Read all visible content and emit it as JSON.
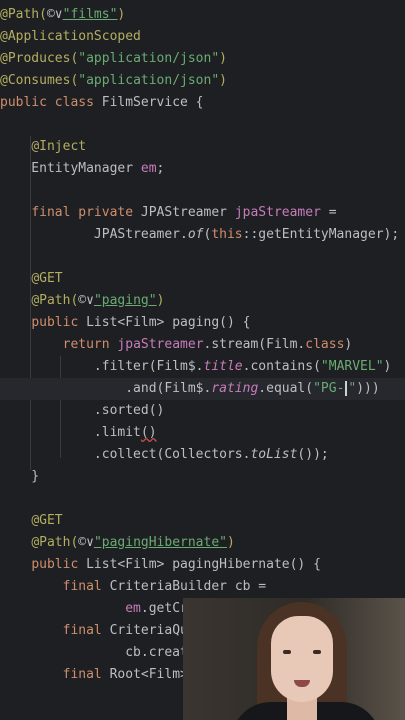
{
  "editor": {
    "lines": [
      {
        "tokens": [
          {
            "t": "@Path(",
            "c": "ann"
          },
          {
            "t": "©∨",
            "c": "hint"
          },
          {
            "t": "\"films\"",
            "c": "str-ul"
          },
          {
            "t": ")",
            "c": "ann"
          }
        ]
      },
      {
        "tokens": [
          {
            "t": "@ApplicationScoped",
            "c": "ann"
          }
        ]
      },
      {
        "tokens": [
          {
            "t": "@Produces(",
            "c": "ann"
          },
          {
            "t": "\"application/json\"",
            "c": "str"
          },
          {
            "t": ")",
            "c": "ann"
          }
        ]
      },
      {
        "tokens": [
          {
            "t": "@Consumes(",
            "c": "ann"
          },
          {
            "t": "\"application/json\"",
            "c": "str"
          },
          {
            "t": ")",
            "c": "ann"
          }
        ]
      },
      {
        "tokens": [
          {
            "t": "public class ",
            "c": "kw"
          },
          {
            "t": "FilmService {",
            "c": "plain"
          }
        ]
      },
      {
        "tokens": []
      },
      {
        "tokens": [
          {
            "t": "    ",
            "c": "plain"
          },
          {
            "t": "@Inject",
            "c": "ann"
          }
        ]
      },
      {
        "tokens": [
          {
            "t": "    EntityManager ",
            "c": "plain"
          },
          {
            "t": "em",
            "c": "field"
          },
          {
            "t": ";",
            "c": "plain"
          }
        ]
      },
      {
        "tokens": []
      },
      {
        "tokens": [
          {
            "t": "    ",
            "c": "plain"
          },
          {
            "t": "final private ",
            "c": "kw"
          },
          {
            "t": "JPAStreamer ",
            "c": "plain"
          },
          {
            "t": "jpaStreamer",
            "c": "field"
          },
          {
            "t": " =",
            "c": "plain"
          }
        ]
      },
      {
        "tokens": [
          {
            "t": "            JPAStreamer.",
            "c": "plain"
          },
          {
            "t": "of",
            "c": "mi"
          },
          {
            "t": "(",
            "c": "plain"
          },
          {
            "t": "this",
            "c": "kw"
          },
          {
            "t": "::getEntityManager);",
            "c": "plain"
          }
        ]
      },
      {
        "tokens": []
      },
      {
        "tokens": [
          {
            "t": "    ",
            "c": "plain"
          },
          {
            "t": "@GET",
            "c": "ann"
          }
        ]
      },
      {
        "tokens": [
          {
            "t": "    ",
            "c": "plain"
          },
          {
            "t": "@Path(",
            "c": "ann"
          },
          {
            "t": "©∨",
            "c": "hint"
          },
          {
            "t": "\"paging\"",
            "c": "str-ul"
          },
          {
            "t": ")",
            "c": "ann"
          }
        ]
      },
      {
        "tokens": [
          {
            "t": "    ",
            "c": "plain"
          },
          {
            "t": "public ",
            "c": "kw"
          },
          {
            "t": "List<Film> paging() {",
            "c": "plain"
          }
        ]
      },
      {
        "tokens": [
          {
            "t": "        ",
            "c": "plain"
          },
          {
            "t": "return ",
            "c": "kw"
          },
          {
            "t": "jpaStreamer",
            "c": "field"
          },
          {
            "t": ".stream(Film.",
            "c": "plain"
          },
          {
            "t": "class",
            "c": "kw"
          },
          {
            "t": ")",
            "c": "plain"
          }
        ]
      },
      {
        "tokens": [
          {
            "t": "            .filter(Film$.",
            "c": "plain"
          },
          {
            "t": "title",
            "c": "fieldi"
          },
          {
            "t": ".contains(",
            "c": "plain"
          },
          {
            "t": "\"MARVEL\"",
            "c": "str"
          },
          {
            "t": ")",
            "c": "plain"
          }
        ]
      },
      {
        "current": true,
        "tokens": [
          {
            "t": "                .and(Film$.",
            "c": "plain"
          },
          {
            "t": "rating",
            "c": "fieldi"
          },
          {
            "t": ".equal(",
            "c": "plain"
          },
          {
            "t": "\"PG-",
            "c": "str"
          },
          {
            "t": "",
            "c": "caret"
          },
          {
            "t": "\"",
            "c": "str"
          },
          {
            "t": ")))",
            "c": "plain"
          }
        ]
      },
      {
        "tokens": [
          {
            "t": "            .sorted()",
            "c": "plain"
          }
        ]
      },
      {
        "tokens": [
          {
            "t": "            .limit",
            "c": "plain"
          },
          {
            "t": "()",
            "c": "plain-wavy"
          }
        ]
      },
      {
        "tokens": [
          {
            "t": "            .collect(Collectors.",
            "c": "plain"
          },
          {
            "t": "toList",
            "c": "mi"
          },
          {
            "t": "());",
            "c": "plain"
          }
        ]
      },
      {
        "tokens": [
          {
            "t": "    }",
            "c": "plain"
          }
        ]
      },
      {
        "tokens": []
      },
      {
        "tokens": [
          {
            "t": "    ",
            "c": "plain"
          },
          {
            "t": "@GET",
            "c": "ann"
          }
        ]
      },
      {
        "tokens": [
          {
            "t": "    ",
            "c": "plain"
          },
          {
            "t": "@Path(",
            "c": "ann"
          },
          {
            "t": "©∨",
            "c": "hint"
          },
          {
            "t": "\"pagingHibernate\"",
            "c": "str-ul"
          },
          {
            "t": ")",
            "c": "ann"
          }
        ]
      },
      {
        "tokens": [
          {
            "t": "    ",
            "c": "plain"
          },
          {
            "t": "public ",
            "c": "kw"
          },
          {
            "t": "List<Film> pagingHibernate() {",
            "c": "plain"
          }
        ]
      },
      {
        "tokens": [
          {
            "t": "        ",
            "c": "plain"
          },
          {
            "t": "final ",
            "c": "kw"
          },
          {
            "t": "CriteriaBuilder cb =",
            "c": "plain"
          }
        ]
      },
      {
        "tokens": [
          {
            "t": "                ",
            "c": "plain"
          },
          {
            "t": "em",
            "c": "field"
          },
          {
            "t": ".getCri",
            "c": "plain"
          }
        ]
      },
      {
        "tokens": [
          {
            "t": "        ",
            "c": "plain"
          },
          {
            "t": "final ",
            "c": "kw"
          },
          {
            "t": "CriteriaQue",
            "c": "plain"
          }
        ]
      },
      {
        "tokens": [
          {
            "t": "                cb.create",
            "c": "plain"
          }
        ]
      },
      {
        "tokens": [
          {
            "t": "        ",
            "c": "plain"
          },
          {
            "t": "final ",
            "c": "kw"
          },
          {
            "t": "Root<Film>",
            "c": "plain"
          }
        ]
      }
    ]
  },
  "theme": {
    "background": "#1e1f22",
    "annotation": "#b3ae60",
    "keyword": "#cf8e6d",
    "string": "#6aab73",
    "field": "#c77dbb"
  },
  "webcam": {
    "label": "presenter-webcam"
  }
}
